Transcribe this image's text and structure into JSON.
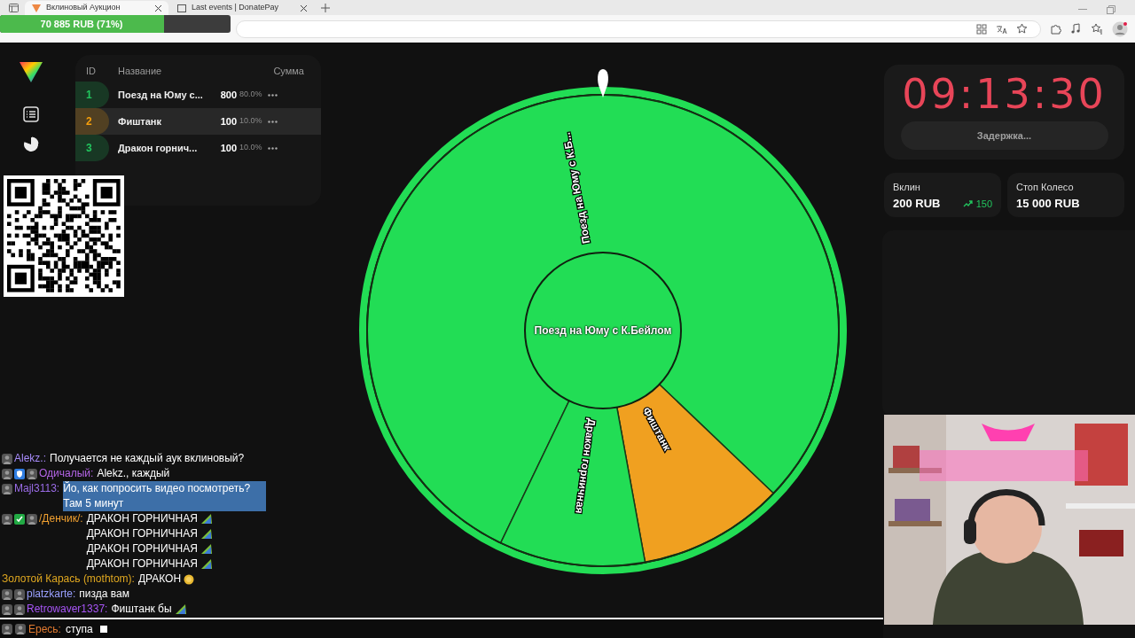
{
  "browser": {
    "tabs": [
      {
        "title": "Вклиновый Аукцион",
        "selected": true
      },
      {
        "title": "Last events | DonatePay",
        "selected": false
      }
    ]
  },
  "goal_overlay": {
    "text": "70 885 RUB (71%)",
    "level": 0.71
  },
  "table": {
    "columns": [
      "ID",
      "Название",
      "Сумма"
    ],
    "rows": [
      {
        "id": "1",
        "name": "Поезд на Юму с...",
        "amount": "800",
        "percent": "80.0%",
        "color": "#22c55e",
        "hovered": false
      },
      {
        "id": "2",
        "name": "Фиштанк",
        "amount": "100",
        "percent": "10.0%",
        "color": "#f59e0b",
        "hovered": true
      },
      {
        "id": "3",
        "name": "Дракон горнич...",
        "amount": "100",
        "percent": "10.0%",
        "color": "#22c55e",
        "hovered": false
      }
    ]
  },
  "wheel": {
    "slices": [
      {
        "label": "Поезд на Юму с К.Б...",
        "color": "#22dd55"
      },
      {
        "label": "Фиштанк",
        "color": "#f0a020"
      },
      {
        "label": "Дракон горничная",
        "color": "#22dd55"
      }
    ],
    "center_label": "Поезд на Юму с К.Бейлом"
  },
  "timer": {
    "time": "09:13:30",
    "button": "Задержка..."
  },
  "stats": [
    {
      "label": "Вклин",
      "value": "200 RUB",
      "trend": "150"
    },
    {
      "label": "Стоп Колесо",
      "value": "15 000 RUB"
    }
  ],
  "chat": {
    "messages": [
      {
        "badges": [
          {
            "kind": "avatar"
          }
        ],
        "user": "Alekz.:",
        "color": "#a78bfa",
        "selected": false,
        "segments": [
          {
            "kind": "text",
            "text": "Получается не каждый аук вклиновый?"
          }
        ]
      },
      {
        "badges": [
          {
            "kind": "avatar"
          },
          {
            "kind": "shield"
          },
          {
            "kind": "avatar"
          }
        ],
        "user": "Одичалый:",
        "color": "#b565e8",
        "selected": false,
        "segments": [
          {
            "kind": "text",
            "text": "Alekz., каждый"
          }
        ]
      },
      {
        "badges": [
          {
            "kind": "avatar"
          }
        ],
        "user": "Majl3113:",
        "color": "#9b6ce8",
        "selected": true,
        "segments": [
          {
            "kind": "text",
            "text": "Йо, как попросить видео посмотреть? Там 5 минут"
          }
        ]
      },
      {
        "badges": [
          {
            "kind": "avatar"
          },
          {
            "kind": "check"
          },
          {
            "kind": "avatar"
          }
        ],
        "user": "/Денчик/:",
        "color": "#f0a030",
        "selected": false,
        "segments": [
          {
            "kind": "text",
            "text": "ДРАКОН ГОРНИЧНАЯ"
          },
          {
            "kind": "emote"
          },
          {
            "kind": "text",
            "text": "ДРАКОН ГОРНИЧНАЯ"
          },
          {
            "kind": "emote"
          },
          {
            "kind": "text",
            "text": "ДРАКОН ГОРНИЧНАЯ"
          },
          {
            "kind": "emote"
          },
          {
            "kind": "text",
            "text": "ДРАКОН ГОРНИЧНАЯ"
          },
          {
            "kind": "emote"
          }
        ]
      },
      {
        "user": "Золотой Карась (mothtom):",
        "color": "#e0a820",
        "selected": false,
        "segments": [
          {
            "kind": "text",
            "text": "ДРАКОН"
          },
          {
            "kind": "coin"
          }
        ]
      },
      {
        "badges": [
          {
            "kind": "avatar"
          },
          {
            "kind": "avatar"
          }
        ],
        "user": "platzkarte:",
        "color": "#9aa0ff",
        "selected": false,
        "segments": [
          {
            "kind": "text",
            "text": "пизда вам"
          }
        ]
      },
      {
        "badges": [
          {
            "kind": "avatar"
          },
          {
            "kind": "avatar"
          }
        ],
        "user": "Retrowaver1337:",
        "color": "#a855f7",
        "selected": false,
        "segments": [
          {
            "kind": "text",
            "text": "Фиштанк бы"
          },
          {
            "kind": "emote"
          }
        ]
      }
    ],
    "input_line": {
      "badges": [
        {
          "kind": "avatar"
        },
        {
          "kind": "avatar"
        }
      ],
      "user": "Ересь:",
      "color": "#e07a30",
      "text": "ступа"
    }
  }
}
